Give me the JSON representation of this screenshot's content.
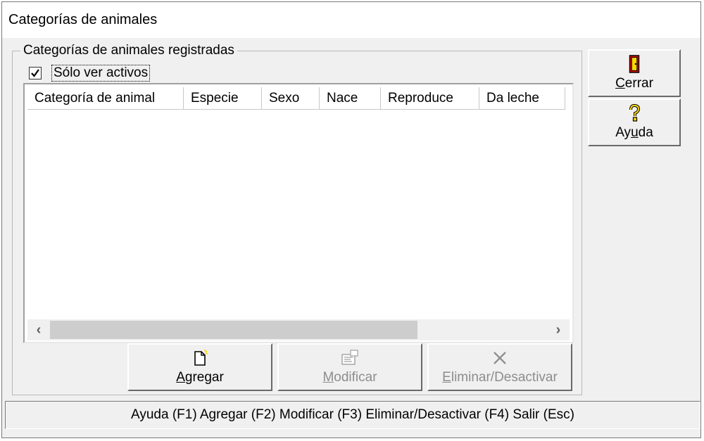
{
  "window": {
    "title": "Categorías de animales"
  },
  "group": {
    "legend": "Categorías de animales registradas",
    "filter_checkbox": {
      "label": "Sólo ver activos",
      "checked": true
    }
  },
  "list": {
    "columns": [
      "Categoría de animal",
      "Especie",
      "Sexo",
      "Nace",
      "Reproduce",
      "Da leche"
    ],
    "rows": []
  },
  "side_buttons": {
    "close": {
      "label": "Cerrar",
      "icon": "exit-door-icon"
    },
    "help": {
      "label": "Ayuda",
      "icon": "question-mark-icon"
    }
  },
  "actions": {
    "add": {
      "label": "Agregar",
      "icon": "new-document-icon",
      "enabled": true
    },
    "modify": {
      "label": "Modificar",
      "icon": "edit-form-icon",
      "enabled": false
    },
    "delete": {
      "label": "Eliminar/Desactivar",
      "icon": "x-icon",
      "enabled": false
    }
  },
  "statusbar": {
    "text": "Ayuda (F1)  Agregar (F2)  Modificar (F3)  Eliminar/Desactivar (F4)  Salir (Esc)"
  }
}
